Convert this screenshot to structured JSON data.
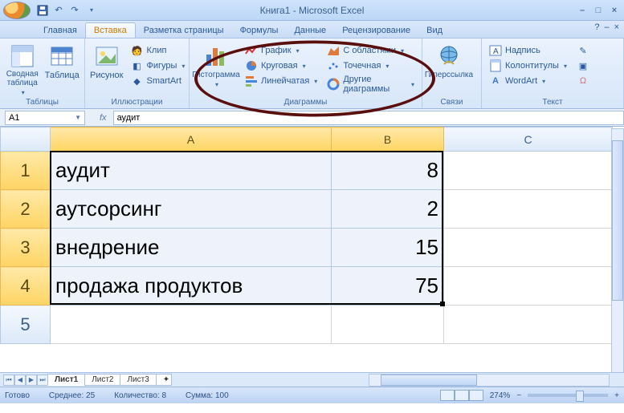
{
  "title": "Книга1 - Microsoft Excel",
  "tabs": {
    "home": "Главная",
    "insert": "Вставка",
    "page_layout": "Разметка страницы",
    "formulas": "Формулы",
    "data": "Данные",
    "review": "Рецензирование",
    "view": "Вид"
  },
  "ribbon": {
    "tables": {
      "pivot": "Сводная таблица",
      "table": "Таблица",
      "group": "Таблицы"
    },
    "illustrations": {
      "picture": "Рисунок",
      "clip": "Клип",
      "shapes": "Фигуры",
      "smartart": "SmartArt",
      "group": "Иллюстрации"
    },
    "charts": {
      "column": "Гистограмма",
      "line": "График",
      "pie": "Круговая",
      "bar": "Линейчатая",
      "area": "С областями",
      "scatter": "Точечная",
      "other": "Другие диаграммы",
      "group": "Диаграммы"
    },
    "links": {
      "hyperlink": "Гиперссылка",
      "group": "Связи"
    },
    "text": {
      "textbox": "Надпись",
      "header_footer": "Колонтитулы",
      "wordart": "WordArt",
      "group": "Текст"
    }
  },
  "namebox": "A1",
  "formula": "аудит",
  "columns": [
    "A",
    "B",
    "C"
  ],
  "rows": {
    "r1": {
      "a": "аудит",
      "b": "8"
    },
    "r2": {
      "a": "аутсорсинг",
      "b": "2"
    },
    "r3": {
      "a": "внедрение",
      "b": "15"
    },
    "r4": {
      "a": "продажа продуктов",
      "b": "75"
    }
  },
  "sheets": {
    "s1": "Лист1",
    "s2": "Лист2",
    "s3": "Лист3"
  },
  "status": {
    "ready": "Готово",
    "avg": "Среднее: 25",
    "count": "Количество: 8",
    "sum": "Сумма: 100",
    "zoom": "274%"
  }
}
